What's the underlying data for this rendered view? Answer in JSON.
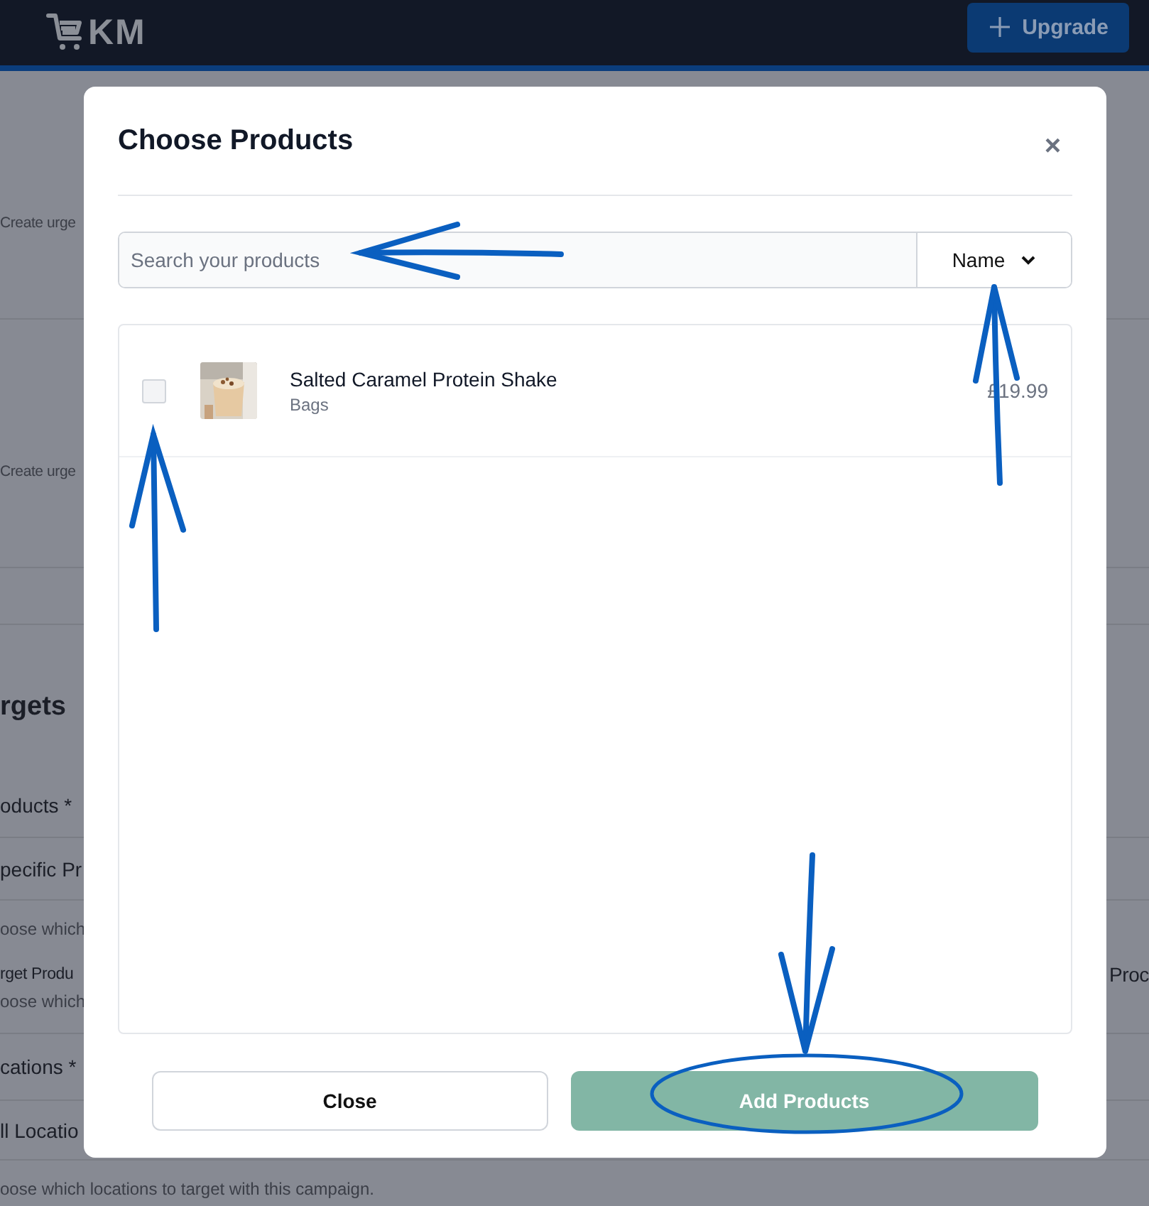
{
  "header": {
    "logo_text": "KM",
    "upgrade_button": "Upgrade"
  },
  "background": {
    "sections": [
      {
        "kind": "note",
        "text": "Create urge"
      },
      {
        "kind": "note",
        "text": "Create urge"
      },
      {
        "kind": "band"
      },
      {
        "kind": "heading",
        "text": "rgets"
      },
      {
        "kind": "label",
        "text": "oducts *"
      },
      {
        "kind": "option",
        "text": "pecific Pr"
      },
      {
        "kind": "hint",
        "text": "oose which"
      },
      {
        "kind": "label2",
        "text": "rget Produ",
        "right": "Proc"
      },
      {
        "kind": "hint2",
        "text": "oose which"
      },
      {
        "kind": "label",
        "text": "cations *"
      },
      {
        "kind": "option",
        "text": "ll Locatio"
      },
      {
        "kind": "hint3",
        "text": "oose which locations to target with this campaign."
      }
    ]
  },
  "modal": {
    "title": "Choose Products",
    "close": "×",
    "search": {
      "placeholder": "Search your products"
    },
    "sort": "Name",
    "products": [
      {
        "name": "Salted Caramel Protein Shake",
        "category": "Bags",
        "price": "£19.99",
        "checked": false
      }
    ],
    "buttons": [
      {
        "label": "Close",
        "kind": "secondary"
      },
      {
        "label": "Add Products",
        "kind": "primary"
      }
    ]
  }
}
